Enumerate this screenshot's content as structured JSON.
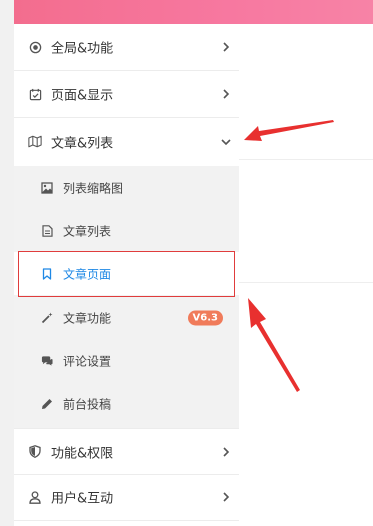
{
  "menu": {
    "items": [
      {
        "label": "全局&功能",
        "icon": "target-icon"
      },
      {
        "label": "页面&显示",
        "icon": "calendar-check-icon"
      },
      {
        "label": "文章&列表",
        "icon": "map-icon",
        "expanded": true
      },
      {
        "label": "功能&权限",
        "icon": "shield-icon"
      },
      {
        "label": "用户&互动",
        "icon": "user-icon"
      }
    ]
  },
  "submenu": {
    "items": [
      {
        "label": "列表缩略图",
        "icon": "image-icon"
      },
      {
        "label": "文章列表",
        "icon": "file-text-icon"
      },
      {
        "label": "文章页面",
        "icon": "bookmark-icon",
        "active": true
      },
      {
        "label": "文章功能",
        "icon": "magic-wand-icon",
        "badge": "V6.3"
      },
      {
        "label": "评论设置",
        "icon": "comments-icon"
      },
      {
        "label": "前台投稿",
        "icon": "pencil-icon"
      }
    ]
  },
  "colors": {
    "header_gradient": "#f36d8e",
    "active_text": "#1e88e5",
    "badge": "#f07b5a",
    "annotation": "#e8302f"
  }
}
